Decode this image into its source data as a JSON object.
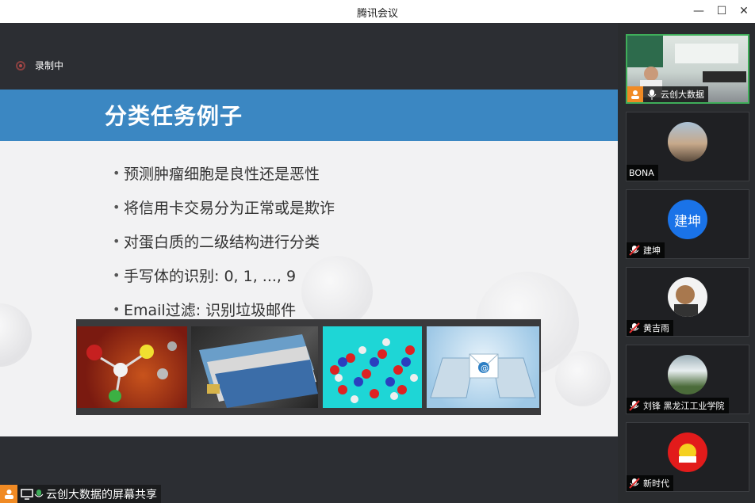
{
  "window": {
    "title": "腾讯会议"
  },
  "recording": {
    "label": "录制中"
  },
  "slide": {
    "title": "分类任务例子",
    "bullets": [
      "预测肿瘤细胞是良性还是恶性",
      "将信用卡交易分为正常或是欺诈",
      "对蛋白质的二级结构进行分类",
      "手写体的识别: 0, 1, ..., 9",
      "Email过滤: 识别垃圾邮件"
    ]
  },
  "participants": [
    {
      "name": "云创大数据"
    },
    {
      "name": "BONA"
    },
    {
      "name": "建坤",
      "avatar_text": "建坤"
    },
    {
      "name": "黄吉雨"
    },
    {
      "name": "刘锋 黑龙江工业学院"
    },
    {
      "name": "新时代"
    }
  ],
  "share": {
    "label": "云创大数据的屏幕共享"
  },
  "colors": {
    "accent": "#3b87c2",
    "active_border": "#3fae5a",
    "avatar_blue": "#1a73e8",
    "orange": "#f08a24"
  }
}
